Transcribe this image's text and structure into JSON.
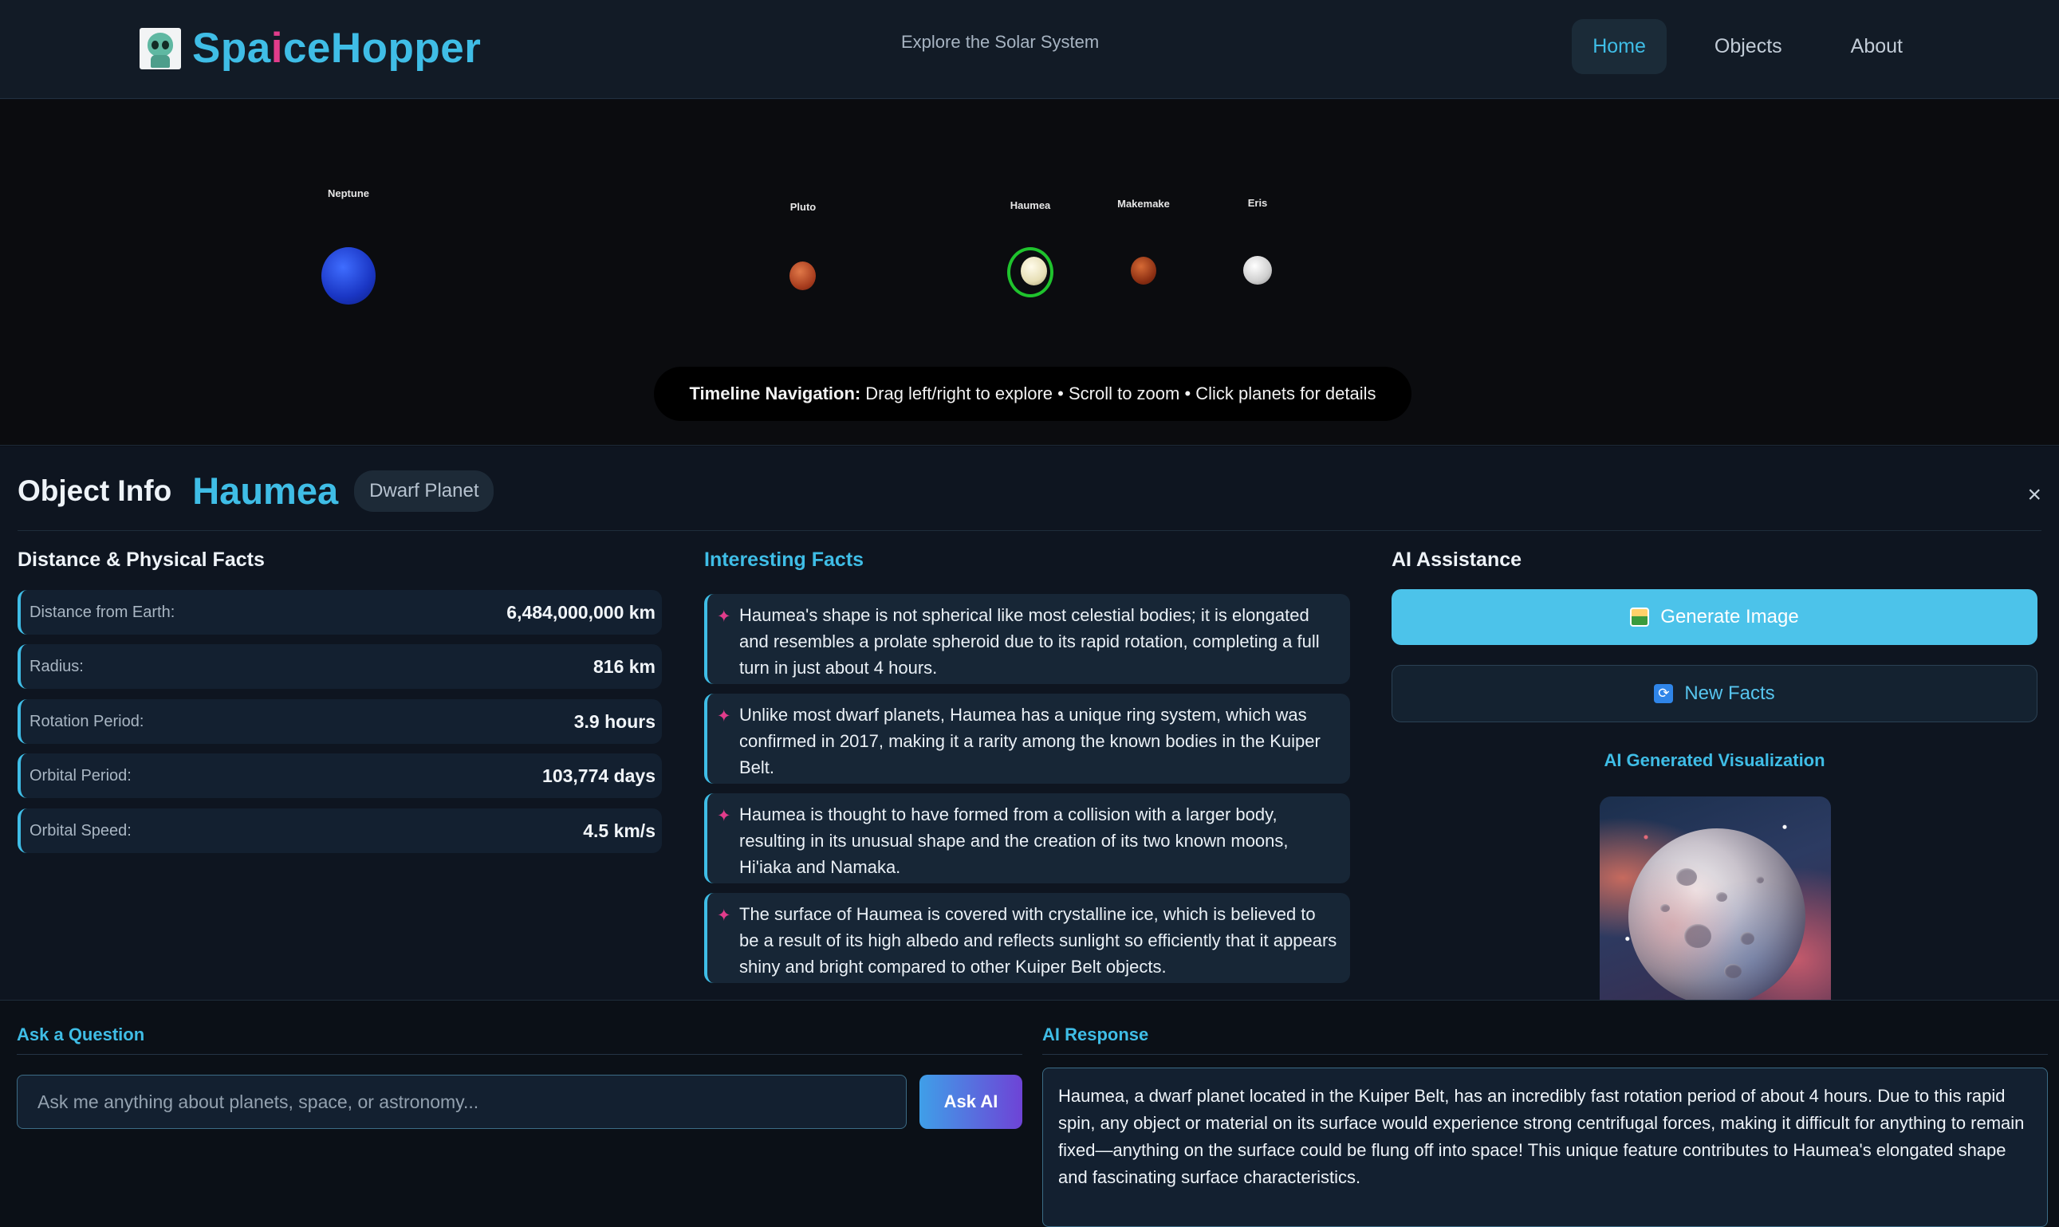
{
  "header": {
    "app_name_prefix": "Spa",
    "app_name_ai": "i",
    "app_name_suffix": "ceHopper",
    "tagline": "Explore the Solar System",
    "nav": [
      {
        "label": "Home",
        "active": true
      },
      {
        "label": "Objects",
        "active": false
      },
      {
        "label": "About",
        "active": false
      }
    ]
  },
  "timeline": {
    "planets": [
      {
        "name": "Neptune"
      },
      {
        "name": "Pluto"
      },
      {
        "name": "Haumea",
        "selected": true
      },
      {
        "name": "Makemake"
      },
      {
        "name": "Eris"
      }
    ],
    "hint_bold": "Timeline Navigation:",
    "hint_text": "Drag left/right to explore • Scroll to zoom • Click planets for details"
  },
  "object_info": {
    "title": "Object Info",
    "name": "Haumea",
    "type_badge": "Dwarf Planet",
    "close": "×",
    "physical_title": "Distance & Physical Facts",
    "facts": [
      {
        "label": "Distance from Earth:",
        "value": "6,484,000,000 km"
      },
      {
        "label": "Radius:",
        "value": "816 km"
      },
      {
        "label": "Rotation Period:",
        "value": "3.9 hours"
      },
      {
        "label": "Orbital Period:",
        "value": "103,774 days"
      },
      {
        "label": "Orbital Speed:",
        "value": "4.5 km/s"
      }
    ],
    "interesting_title": "Interesting Facts",
    "interesting": [
      "Haumea's shape is not spherical like most celestial bodies; it is elongated and resembles a prolate spheroid due to its rapid rotation, completing a full turn in just about 4 hours.",
      "Unlike most dwarf planets, Haumea has a unique ring system, which was confirmed in 2017, making it a rarity among the known bodies in the Kuiper Belt.",
      "Haumea is thought to have formed from a collision with a larger body, resulting in its unusual shape and the creation of its two known moons, Hi'iaka and Namaka.",
      "The surface of Haumea is covered with crystalline ice, which is believed to be a result of its high albedo and reflects sunlight so efficiently that it appears shiny and bright compared to other Kuiper Belt objects."
    ],
    "ai_title": "AI Assistance",
    "generate_label": "Generate Image",
    "new_facts_label": "New Facts",
    "viz_title": "AI Generated Visualization"
  },
  "ask": {
    "title": "Ask a Question",
    "placeholder": "Ask me anything about planets, space, or astronomy...",
    "button": "Ask AI"
  },
  "response": {
    "title": "AI Response",
    "text": "Haumea, a dwarf planet located in the Kuiper Belt, has an incredibly fast rotation period of about 4 hours. Due to this rapid spin, any object or material on its surface would experience strong centrifugal forces, making it difficult for anything to remain fixed—anything on the surface could be flung off into space! This unique feature contributes to Haumea's elongated shape and fascinating surface characteristics."
  },
  "colors": {
    "accent": "#3fbde6",
    "brand_ai": "#e23c8b",
    "selection_ring": "#1fc32d",
    "background": "#0b1017"
  }
}
